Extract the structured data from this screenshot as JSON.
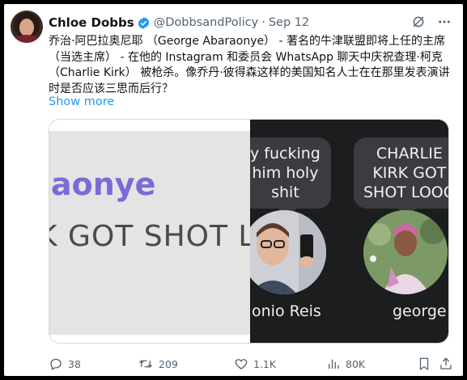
{
  "tweet": {
    "author_name": "Chloe Dobbs",
    "handle": "@DobbsandPolicy",
    "separator": "·",
    "date": "Sep 12",
    "text": "乔治·阿巴拉奥尼耶 （George Abaraonye） - 著名的牛津联盟即将上任的主席（当选主席） - 在他的 Instagram 和委员会 WhatsApp 聊天中庆祝查理·柯克（Charlie Kirk） 被枪杀。像乔丹·彼得森这样的美国知名人士在在那里发表演讲时是否应该三思而后行？",
    "show_more": "Show more",
    "icons": {
      "verified": "verified-badge-icon",
      "grok": "grok-icon",
      "more": "more-dots-icon"
    }
  },
  "media": {
    "left_text_1": "aonye",
    "left_text_2": "K GOT SHOT L",
    "bubble_1": "y fucking\nhim holy\nshit",
    "bubble_2": "CHARLIE\nKIRK GOT\nSHOT LOOO",
    "caption_1": "onio Reis",
    "caption_2": "george"
  },
  "actions": {
    "reply_count": "38",
    "retweet_count": "209",
    "like_count": "1.1K",
    "views_count": "80K",
    "icons": [
      "reply-icon",
      "retweet-icon",
      "like-icon",
      "views-icon",
      "bookmark-icon",
      "share-icon"
    ]
  },
  "colors": {
    "link": "#1d9bf0",
    "verified": "#1d9bf0",
    "secondary_text": "#536471"
  }
}
